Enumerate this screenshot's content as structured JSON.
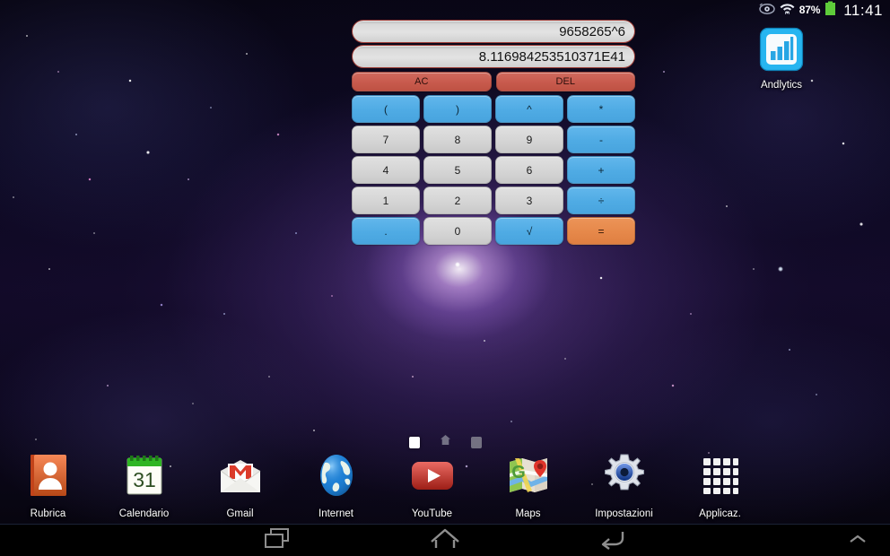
{
  "status_bar": {
    "icons": [
      "smart-stay-eye-icon",
      "wifi-icon"
    ],
    "battery_percent": "87%",
    "battery_icon": "battery-full-icon",
    "battery_color": "#5ecc3a",
    "time": "11:41"
  },
  "calculator": {
    "name": "calculator-widget",
    "input_expression": "9658265^6",
    "result": "8.116984253510371E41",
    "colors": {
      "clear": "#c85a4d",
      "operator": "#4fabe4",
      "digit": "#d5d5d5",
      "equals": "#e6884a",
      "display_border": "#9b3a34"
    },
    "rows": [
      [
        {
          "label": "AC",
          "style": "red",
          "name": "calc-key-ac"
        },
        {
          "label": "DEL",
          "style": "red",
          "name": "calc-key-del"
        }
      ],
      [
        {
          "label": "(",
          "style": "blue",
          "name": "calc-key-open-paren"
        },
        {
          "label": ")",
          "style": "blue",
          "name": "calc-key-close-paren"
        },
        {
          "label": "^",
          "style": "blue",
          "name": "calc-key-power"
        },
        {
          "label": "*",
          "style": "blue",
          "name": "calc-key-multiply"
        }
      ],
      [
        {
          "label": "7",
          "style": "gray",
          "name": "calc-key-7"
        },
        {
          "label": "8",
          "style": "gray",
          "name": "calc-key-8"
        },
        {
          "label": "9",
          "style": "gray",
          "name": "calc-key-9"
        },
        {
          "label": "-",
          "style": "blue",
          "name": "calc-key-minus"
        }
      ],
      [
        {
          "label": "4",
          "style": "gray",
          "name": "calc-key-4"
        },
        {
          "label": "5",
          "style": "gray",
          "name": "calc-key-5"
        },
        {
          "label": "6",
          "style": "gray",
          "name": "calc-key-6"
        },
        {
          "label": "+",
          "style": "blue",
          "name": "calc-key-plus"
        }
      ],
      [
        {
          "label": "1",
          "style": "gray",
          "name": "calc-key-1"
        },
        {
          "label": "2",
          "style": "gray",
          "name": "calc-key-2"
        },
        {
          "label": "3",
          "style": "gray",
          "name": "calc-key-3"
        },
        {
          "label": "÷",
          "style": "blue",
          "name": "calc-key-divide"
        }
      ],
      [
        {
          "label": ".",
          "style": "blue",
          "name": "calc-key-decimal"
        },
        {
          "label": "0",
          "style": "gray",
          "name": "calc-key-0"
        },
        {
          "label": "√",
          "style": "blue",
          "name": "calc-key-sqrt"
        },
        {
          "label": "=",
          "style": "orange",
          "name": "calc-key-equals"
        }
      ]
    ]
  },
  "home_icons": [
    {
      "label": "Andlytics",
      "icon": "andlytics-bar-chart-icon"
    }
  ],
  "page_indicator": {
    "pages": [
      {
        "type": "square",
        "state": "active",
        "name": "page-dot-1"
      },
      {
        "type": "home",
        "state": "dim",
        "name": "page-dot-home"
      },
      {
        "type": "square",
        "state": "dim",
        "name": "page-dot-3"
      }
    ]
  },
  "dock": {
    "items": [
      {
        "label": "Rubrica",
        "icon": "contacts-icon"
      },
      {
        "label": "Calendario",
        "icon": "calendar-icon",
        "day": "31"
      },
      {
        "label": "Gmail",
        "icon": "gmail-envelope-icon"
      },
      {
        "label": "Internet",
        "icon": "browser-globe-icon"
      },
      {
        "label": "YouTube",
        "icon": "youtube-play-icon"
      },
      {
        "label": "Maps",
        "icon": "maps-pin-icon"
      },
      {
        "label": "Impostazioni",
        "icon": "settings-gear-icon"
      },
      {
        "label": "Applicaz.",
        "icon": "app-drawer-grid-icon"
      }
    ]
  },
  "nav_bar": {
    "buttons": [
      {
        "name": "recents-button",
        "icon": "recents-icon"
      },
      {
        "name": "home-button",
        "icon": "home-icon"
      },
      {
        "name": "back-button",
        "icon": "back-arrow-icon"
      },
      {
        "name": "expand-button",
        "icon": "chevron-up-icon"
      }
    ]
  }
}
